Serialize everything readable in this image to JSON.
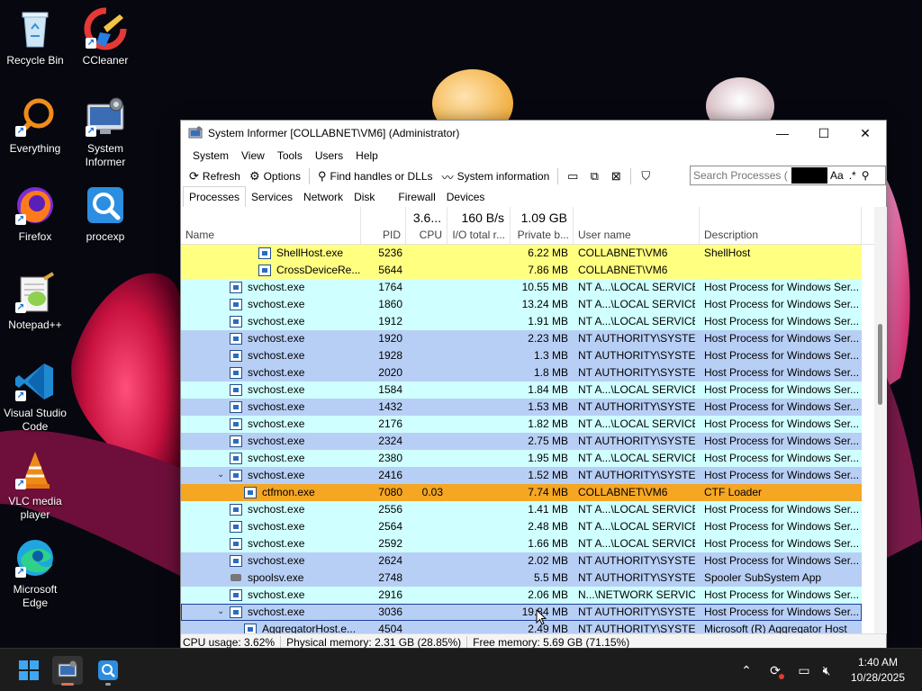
{
  "desktop": {
    "icons": [
      {
        "label": "Recycle Bin",
        "icon": "recycle-bin-icon"
      },
      {
        "label": "CCleaner",
        "icon": "ccleaner-icon"
      },
      {
        "label": "Everything",
        "icon": "everything-icon"
      },
      {
        "label": "System Informer",
        "icon": "system-informer-icon"
      },
      {
        "label": "Firefox",
        "icon": "firefox-icon"
      },
      {
        "label": "procexp",
        "icon": "procexp-icon"
      },
      {
        "label": "Notepad++",
        "icon": "notepadpp-icon"
      },
      {
        "label": "Visual Studio Code",
        "icon": "vscode-icon"
      },
      {
        "label": "VLC media player",
        "icon": "vlc-icon"
      },
      {
        "label": "Microsoft Edge",
        "icon": "edge-icon"
      }
    ]
  },
  "window": {
    "title": "System Informer [COLLABNET\\VM6] (Administrator)",
    "menu": [
      "System",
      "View",
      "Tools",
      "Users",
      "Help"
    ],
    "toolbar": {
      "refresh": "Refresh",
      "options": "Options",
      "find_handles": "Find handles or DLLs",
      "system_information": "System information"
    },
    "search": {
      "placeholder": "Search Processes (",
      "case_label": "Aa",
      "regex_label": ".*"
    },
    "tabs": [
      "Processes",
      "Services",
      "Network",
      "Disk",
      "Firewall",
      "Devices"
    ],
    "active_tab": "Processes",
    "columns": {
      "name": "Name",
      "pid": "PID",
      "cpu": "CPU",
      "cpu_total": "3.6...",
      "io": "I/O total r...",
      "io_total": "160 B/s",
      "private": "Private b...",
      "private_total": "1.09 GB",
      "user": "User name",
      "description": "Description"
    },
    "rows": [
      {
        "name": "ShellHost.exe",
        "pid": "5236",
        "cpu": "",
        "private": "6.22 MB",
        "user": "COLLABNET\\VM6",
        "desc": "ShellHost"
      },
      {
        "name": "CrossDeviceRe...",
        "pid": "5644",
        "cpu": "",
        "private": "7.86 MB",
        "user": "COLLABNET\\VM6",
        "desc": ""
      },
      {
        "name": "svchost.exe",
        "pid": "1764",
        "cpu": "",
        "private": "10.55 MB",
        "user": "NT A...\\LOCAL SERVICE",
        "desc": "Host Process for Windows Ser..."
      },
      {
        "name": "svchost.exe",
        "pid": "1860",
        "cpu": "",
        "private": "13.24 MB",
        "user": "NT A...\\LOCAL SERVICE",
        "desc": "Host Process for Windows Ser..."
      },
      {
        "name": "svchost.exe",
        "pid": "1912",
        "cpu": "",
        "private": "1.91 MB",
        "user": "NT A...\\LOCAL SERVICE",
        "desc": "Host Process for Windows Ser..."
      },
      {
        "name": "svchost.exe",
        "pid": "1920",
        "cpu": "",
        "private": "2.23 MB",
        "user": "NT AUTHORITY\\SYSTEM",
        "desc": "Host Process for Windows Ser..."
      },
      {
        "name": "svchost.exe",
        "pid": "1928",
        "cpu": "",
        "private": "1.3 MB",
        "user": "NT AUTHORITY\\SYSTEM",
        "desc": "Host Process for Windows Ser..."
      },
      {
        "name": "svchost.exe",
        "pid": "2020",
        "cpu": "",
        "private": "1.8 MB",
        "user": "NT AUTHORITY\\SYSTEM",
        "desc": "Host Process for Windows Ser..."
      },
      {
        "name": "svchost.exe",
        "pid": "1584",
        "cpu": "",
        "private": "1.84 MB",
        "user": "NT A...\\LOCAL SERVICE",
        "desc": "Host Process for Windows Ser..."
      },
      {
        "name": "svchost.exe",
        "pid": "1432",
        "cpu": "",
        "private": "1.53 MB",
        "user": "NT AUTHORITY\\SYSTEM",
        "desc": "Host Process for Windows Ser..."
      },
      {
        "name": "svchost.exe",
        "pid": "2176",
        "cpu": "",
        "private": "1.82 MB",
        "user": "NT A...\\LOCAL SERVICE",
        "desc": "Host Process for Windows Ser..."
      },
      {
        "name": "svchost.exe",
        "pid": "2324",
        "cpu": "",
        "private": "2.75 MB",
        "user": "NT AUTHORITY\\SYSTEM",
        "desc": "Host Process for Windows Ser..."
      },
      {
        "name": "svchost.exe",
        "pid": "2380",
        "cpu": "",
        "private": "1.95 MB",
        "user": "NT A...\\LOCAL SERVICE",
        "desc": "Host Process for Windows Ser..."
      },
      {
        "name": "svchost.exe",
        "pid": "2416",
        "cpu": "",
        "private": "1.52 MB",
        "user": "NT AUTHORITY\\SYSTEM",
        "desc": "Host Process for Windows Ser..."
      },
      {
        "name": "ctfmon.exe",
        "pid": "7080",
        "cpu": "0.03",
        "private": "7.74 MB",
        "user": "COLLABNET\\VM6",
        "desc": "CTF Loader"
      },
      {
        "name": "svchost.exe",
        "pid": "2556",
        "cpu": "",
        "private": "1.41 MB",
        "user": "NT A...\\LOCAL SERVICE",
        "desc": "Host Process for Windows Ser..."
      },
      {
        "name": "svchost.exe",
        "pid": "2564",
        "cpu": "",
        "private": "2.48 MB",
        "user": "NT A...\\LOCAL SERVICE",
        "desc": "Host Process for Windows Ser..."
      },
      {
        "name": "svchost.exe",
        "pid": "2592",
        "cpu": "",
        "private": "1.66 MB",
        "user": "NT A...\\LOCAL SERVICE",
        "desc": "Host Process for Windows Ser..."
      },
      {
        "name": "svchost.exe",
        "pid": "2624",
        "cpu": "",
        "private": "2.02 MB",
        "user": "NT AUTHORITY\\SYSTEM",
        "desc": "Host Process for Windows Ser..."
      },
      {
        "name": "spoolsv.exe",
        "pid": "2748",
        "cpu": "",
        "private": "5.5 MB",
        "user": "NT AUTHORITY\\SYSTEM",
        "desc": "Spooler SubSystem App"
      },
      {
        "name": "svchost.exe",
        "pid": "2916",
        "cpu": "",
        "private": "2.06 MB",
        "user": "N...\\NETWORK SERVICE",
        "desc": "Host Process for Windows Ser..."
      },
      {
        "name": "svchost.exe",
        "pid": "3036",
        "cpu": "",
        "private": "19.84 MB",
        "user": "NT AUTHORITY\\SYSTEM",
        "desc": "Host Process for Windows Ser..."
      },
      {
        "name": "AggregatorHost.e...",
        "pid": "4504",
        "cpu": "",
        "private": "2.49 MB",
        "user": "NT AUTHORITY\\SYSTEM",
        "desc": "Microsoft (R) Aggregator Host"
      }
    ],
    "status": {
      "cpu": "CPU usage: 3.62%",
      "physical": "Physical memory: 2.31 GB (28.85%)",
      "free": "Free memory: 5.69 GB (71.15%)"
    }
  },
  "colors": {
    "user_process": "#ffff80",
    "service_light": "#d0ffff",
    "service_system": "#b8cff5",
    "highlighted": "#f5a623",
    "selected_border": "#1c3f9a"
  },
  "taskbar": {
    "clock_time": "1:40 AM",
    "clock_date": "10/28/2025",
    "pinned": [
      "start-icon",
      "system-informer-icon",
      "procexp-icon"
    ]
  }
}
